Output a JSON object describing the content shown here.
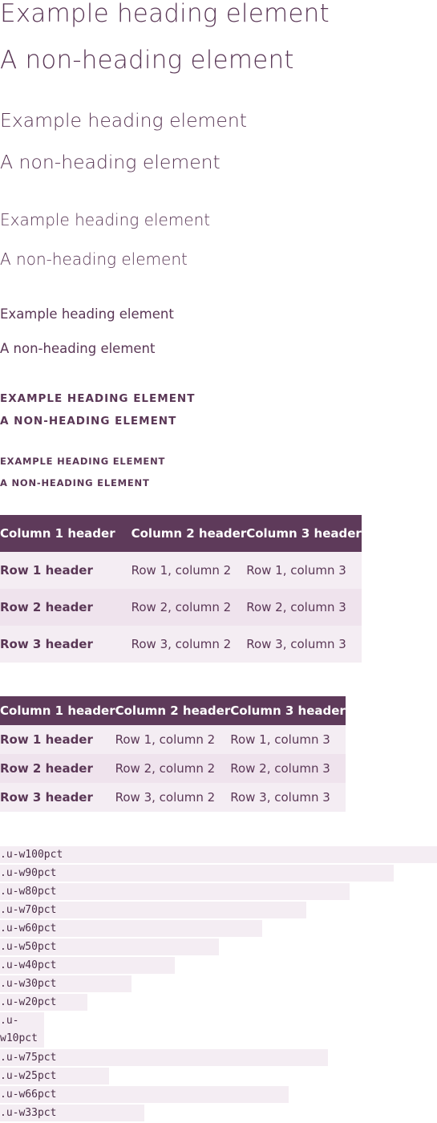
{
  "headings": [
    {
      "heading": "Example heading element",
      "non_heading": "A non-heading element"
    },
    {
      "heading": "Example heading element",
      "non_heading": "A non-heading element"
    },
    {
      "heading": "Example heading element",
      "non_heading": "A non-heading element"
    },
    {
      "heading": "Example heading element",
      "non_heading": "A non-heading element"
    },
    {
      "heading": "Example heading element",
      "non_heading": "A non-heading element"
    },
    {
      "heading": "Example heading element",
      "non_heading": "A non-heading element"
    }
  ],
  "table_large": {
    "columns": [
      "Column 1 header",
      "Column 2 header",
      "Column 3 header"
    ],
    "rows": [
      [
        "Row 1 header",
        "Row 1, column 2",
        "Row 1, column 3"
      ],
      [
        "Row 2 header",
        "Row 2, column 2",
        "Row 2, column 3"
      ],
      [
        "Row 3 header",
        "Row 3, column 2",
        "Row 3, column 3"
      ]
    ]
  },
  "table_compact": {
    "columns": [
      "Column 1 header",
      "Column 2 header",
      "Column 3 header"
    ],
    "rows": [
      [
        "Row 1 header",
        "Row 1, column 2",
        "Row 1, column 3"
      ],
      [
        "Row 2 header",
        "Row 2, column 2",
        "Row 2, column 3"
      ],
      [
        "Row 3 header",
        "Row 3, column 2",
        "Row 3, column 3"
      ]
    ]
  },
  "width_utilities": [
    {
      "label": ".u-w100pct",
      "fraction": 1.0
    },
    {
      "label": ".u-w90pct",
      "fraction": 0.9
    },
    {
      "label": ".u-w80pct",
      "fraction": 0.8
    },
    {
      "label": ".u-w70pct",
      "fraction": 0.7
    },
    {
      "label": ".u-w60pct",
      "fraction": 0.6
    },
    {
      "label": ".u-w50pct",
      "fraction": 0.5
    },
    {
      "label": ".u-w40pct",
      "fraction": 0.4
    },
    {
      "label": ".u-w30pct",
      "fraction": 0.3
    },
    {
      "label": ".u-w20pct",
      "fraction": 0.2
    },
    {
      "label": ".u-w10pct",
      "label_lines": [
        ".u-",
        "w10pct"
      ],
      "fraction": 0.1
    },
    {
      "label": ".u-w75pct",
      "fraction": 0.75
    },
    {
      "label": ".u-w25pct",
      "fraction": 0.25
    },
    {
      "label": ".u-w66pct",
      "fraction": 0.66
    },
    {
      "label": ".u-w33pct",
      "fraction": 0.33
    }
  ],
  "colors": {
    "text": "#5a3756",
    "table_header_bg": "#5e3a5a",
    "row_odd_bg": "#f4edf3",
    "row_even_bg": "#efe3ed",
    "bar_bg": "#f4edf3"
  }
}
